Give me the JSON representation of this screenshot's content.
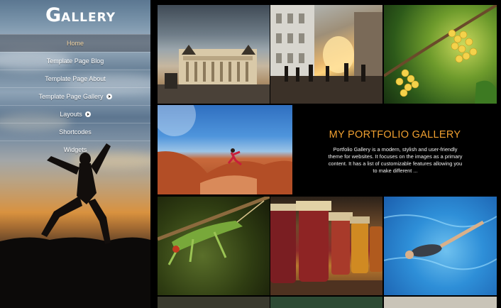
{
  "site": {
    "logo_initial": "G",
    "logo_rest": "ALLERY"
  },
  "nav": {
    "items": [
      {
        "label": "Home",
        "active": true,
        "submenu": false
      },
      {
        "label": "Template Page Blog",
        "active": false,
        "submenu": false
      },
      {
        "label": "Template Page About",
        "active": false,
        "submenu": false
      },
      {
        "label": "Template Page Gallery",
        "active": false,
        "submenu": true
      },
      {
        "label": "Layouts",
        "active": false,
        "submenu": true
      },
      {
        "label": "Shortcodes",
        "active": false,
        "submenu": false
      },
      {
        "label": "Widgets",
        "active": false,
        "submenu": false
      }
    ]
  },
  "portfolio": {
    "title": "MY PORTFOLIO GALLERY",
    "description": "Portfolio Gallery is a modern, stylish and user-friendly theme for websites. It focuses on the images as a primary content. It has a list of customizable features allowing you to make different ..."
  },
  "colors": {
    "accent": "#f0a030",
    "background": "#000000",
    "nav_text": "#ffffff"
  }
}
